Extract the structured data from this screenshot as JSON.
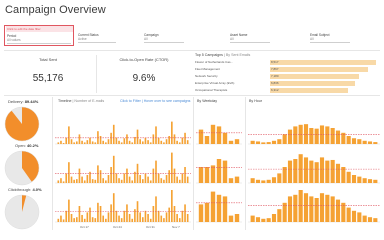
{
  "title": "Campaign Overview",
  "filters": {
    "hint": "Click to edit the date filter",
    "period_label": "Period",
    "period_value": "All values",
    "items": [
      {
        "label": "Current Status",
        "value": "Active"
      },
      {
        "label": "Campaign",
        "value": "All"
      },
      {
        "label": "Asset Name",
        "value": "All"
      },
      {
        "label": "Email Subject",
        "value": "All"
      }
    ]
  },
  "kpis": {
    "total_sent_label": "Total Sent",
    "total_sent_value": "55,176",
    "ctor_label": "Click-to-Open Rate (CTOR)",
    "ctor_value": "9.6%"
  },
  "top5": {
    "title": "Top 5 Campaigns",
    "subtitle": " | By Sent Emails",
    "rows": [
      {
        "name": "Flower of Netherlands Cas...",
        "value": "8,517",
        "fraction": 1.0
      },
      {
        "name": "Fleet Management",
        "value": "7,867",
        "fraction": 0.92
      },
      {
        "name": "Network Security",
        "value": "7,180",
        "fraction": 0.84
      },
      {
        "name": "Enterprise Virtual Array (EVA)",
        "value": "6,836",
        "fraction": 0.8
      },
      {
        "name": "Occupational Therapists",
        "value": "6,312",
        "fraction": 0.74
      }
    ]
  },
  "gauges": [
    {
      "label": "Delivery:",
      "value_text": "89.44%",
      "fraction": 0.894
    },
    {
      "label": "Open:",
      "value_text": "40.2%",
      "fraction": 0.402
    },
    {
      "label": "Clickthrough:",
      "value_text": "4.0%",
      "fraction": 0.04
    }
  ],
  "timeline": {
    "title": "Timeline",
    "subtitle": " | Number of E-mails",
    "link": "Click to Filter | Hover over to see campaigns",
    "x_ticks": [
      "Oct 17",
      "Oct 24",
      "Oct 31",
      "Nov 7"
    ]
  },
  "by_weekday": {
    "title": "By Weekday"
  },
  "by_hour": {
    "title": "By Hour"
  },
  "colors": {
    "accent": "#f5a233",
    "accent_light": "#f8d9a7",
    "gauge_fill": "#f28e2b",
    "gauge_track": "#e8e8e8",
    "ref_line": "#e05660",
    "filter_border": "#e05660"
  },
  "chart_data": [
    {
      "type": "bar",
      "title": "Timeline",
      "x_ticks": [
        "Oct 17",
        "Oct 24",
        "Oct 31",
        "Nov 7"
      ],
      "series": [
        {
          "values": [
            0.05,
            0.1,
            0.03,
            0.2,
            0.55,
            0.15,
            0.05,
            0.08,
            0.3,
            0.1,
            0.05,
            0.12,
            0.2,
            0.08,
            0.05,
            0.4,
            0.25,
            0.1,
            0.05,
            0.15,
            0.35,
            0.6,
            0.2,
            0.1,
            0.05,
            0.18,
            0.3,
            0.1,
            0.05,
            0.22,
            0.45,
            0.15,
            0.08,
            0.2,
            0.12,
            0.05,
            0.3,
            0.55,
            0.2,
            0.1,
            0.05,
            0.15,
            0.25,
            0.7,
            0.3,
            0.1,
            0.05,
            0.2,
            0.35,
            0.12
          ]
        },
        {
          "values": [
            0.08,
            0.15,
            0.05,
            0.3,
            0.65,
            0.2,
            0.1,
            0.12,
            0.45,
            0.2,
            0.08,
            0.25,
            0.35,
            0.12,
            0.1,
            0.55,
            0.4,
            0.15,
            0.08,
            0.25,
            0.5,
            0.85,
            0.3,
            0.15,
            0.1,
            0.3,
            0.45,
            0.2,
            0.08,
            0.35,
            0.6,
            0.25,
            0.12,
            0.3,
            0.2,
            0.08,
            0.45,
            0.7,
            0.3,
            0.15,
            0.1,
            0.25,
            0.4,
            0.95,
            0.45,
            0.2,
            0.1,
            0.3,
            0.5,
            0.2
          ]
        },
        {
          "values": [
            0.1,
            0.2,
            0.08,
            0.35,
            0.7,
            0.25,
            0.12,
            0.15,
            0.5,
            0.22,
            0.1,
            0.3,
            0.45,
            0.15,
            0.12,
            0.6,
            0.5,
            0.2,
            0.1,
            0.3,
            0.55,
            0.9,
            0.35,
            0.2,
            0.12,
            0.35,
            0.55,
            0.25,
            0.1,
            0.4,
            0.65,
            0.3,
            0.15,
            0.35,
            0.25,
            0.1,
            0.5,
            0.8,
            0.35,
            0.2,
            0.12,
            0.3,
            0.45,
            1.0,
            0.5,
            0.25,
            0.12,
            0.35,
            0.55,
            0.25
          ]
        }
      ]
    },
    {
      "type": "bar",
      "title": "By Weekday",
      "series": [
        {
          "values": [
            0.45,
            0.25,
            0.6,
            0.55,
            0.35,
            0.1,
            0.15
          ]
        },
        {
          "values": [
            0.5,
            0.5,
            0.55,
            0.75,
            0.7,
            0.15,
            0.2
          ]
        },
        {
          "values": [
            0.55,
            0.6,
            0.95,
            0.85,
            0.8,
            0.2,
            0.25
          ]
        }
      ]
    },
    {
      "type": "bar",
      "title": "By Hour",
      "series": [
        {
          "values": [
            0.1,
            0.08,
            0.05,
            0.06,
            0.1,
            0.15,
            0.3,
            0.45,
            0.55,
            0.6,
            0.62,
            0.5,
            0.48,
            0.58,
            0.55,
            0.5,
            0.42,
            0.35,
            0.25,
            0.18,
            0.15,
            0.1,
            0.08,
            0.06
          ]
        },
        {
          "values": [
            0.15,
            0.1,
            0.08,
            0.1,
            0.18,
            0.3,
            0.5,
            0.7,
            0.75,
            0.9,
            0.8,
            0.7,
            0.65,
            0.8,
            0.7,
            0.72,
            0.6,
            0.5,
            0.35,
            0.25,
            0.2,
            0.15,
            0.12,
            0.1
          ]
        },
        {
          "values": [
            0.2,
            0.15,
            0.1,
            0.12,
            0.25,
            0.4,
            0.6,
            0.8,
            0.85,
            1.0,
            0.9,
            0.8,
            0.75,
            0.9,
            0.85,
            0.8,
            0.7,
            0.6,
            0.45,
            0.35,
            0.3,
            0.2,
            0.15,
            0.12
          ]
        }
      ]
    }
  ]
}
